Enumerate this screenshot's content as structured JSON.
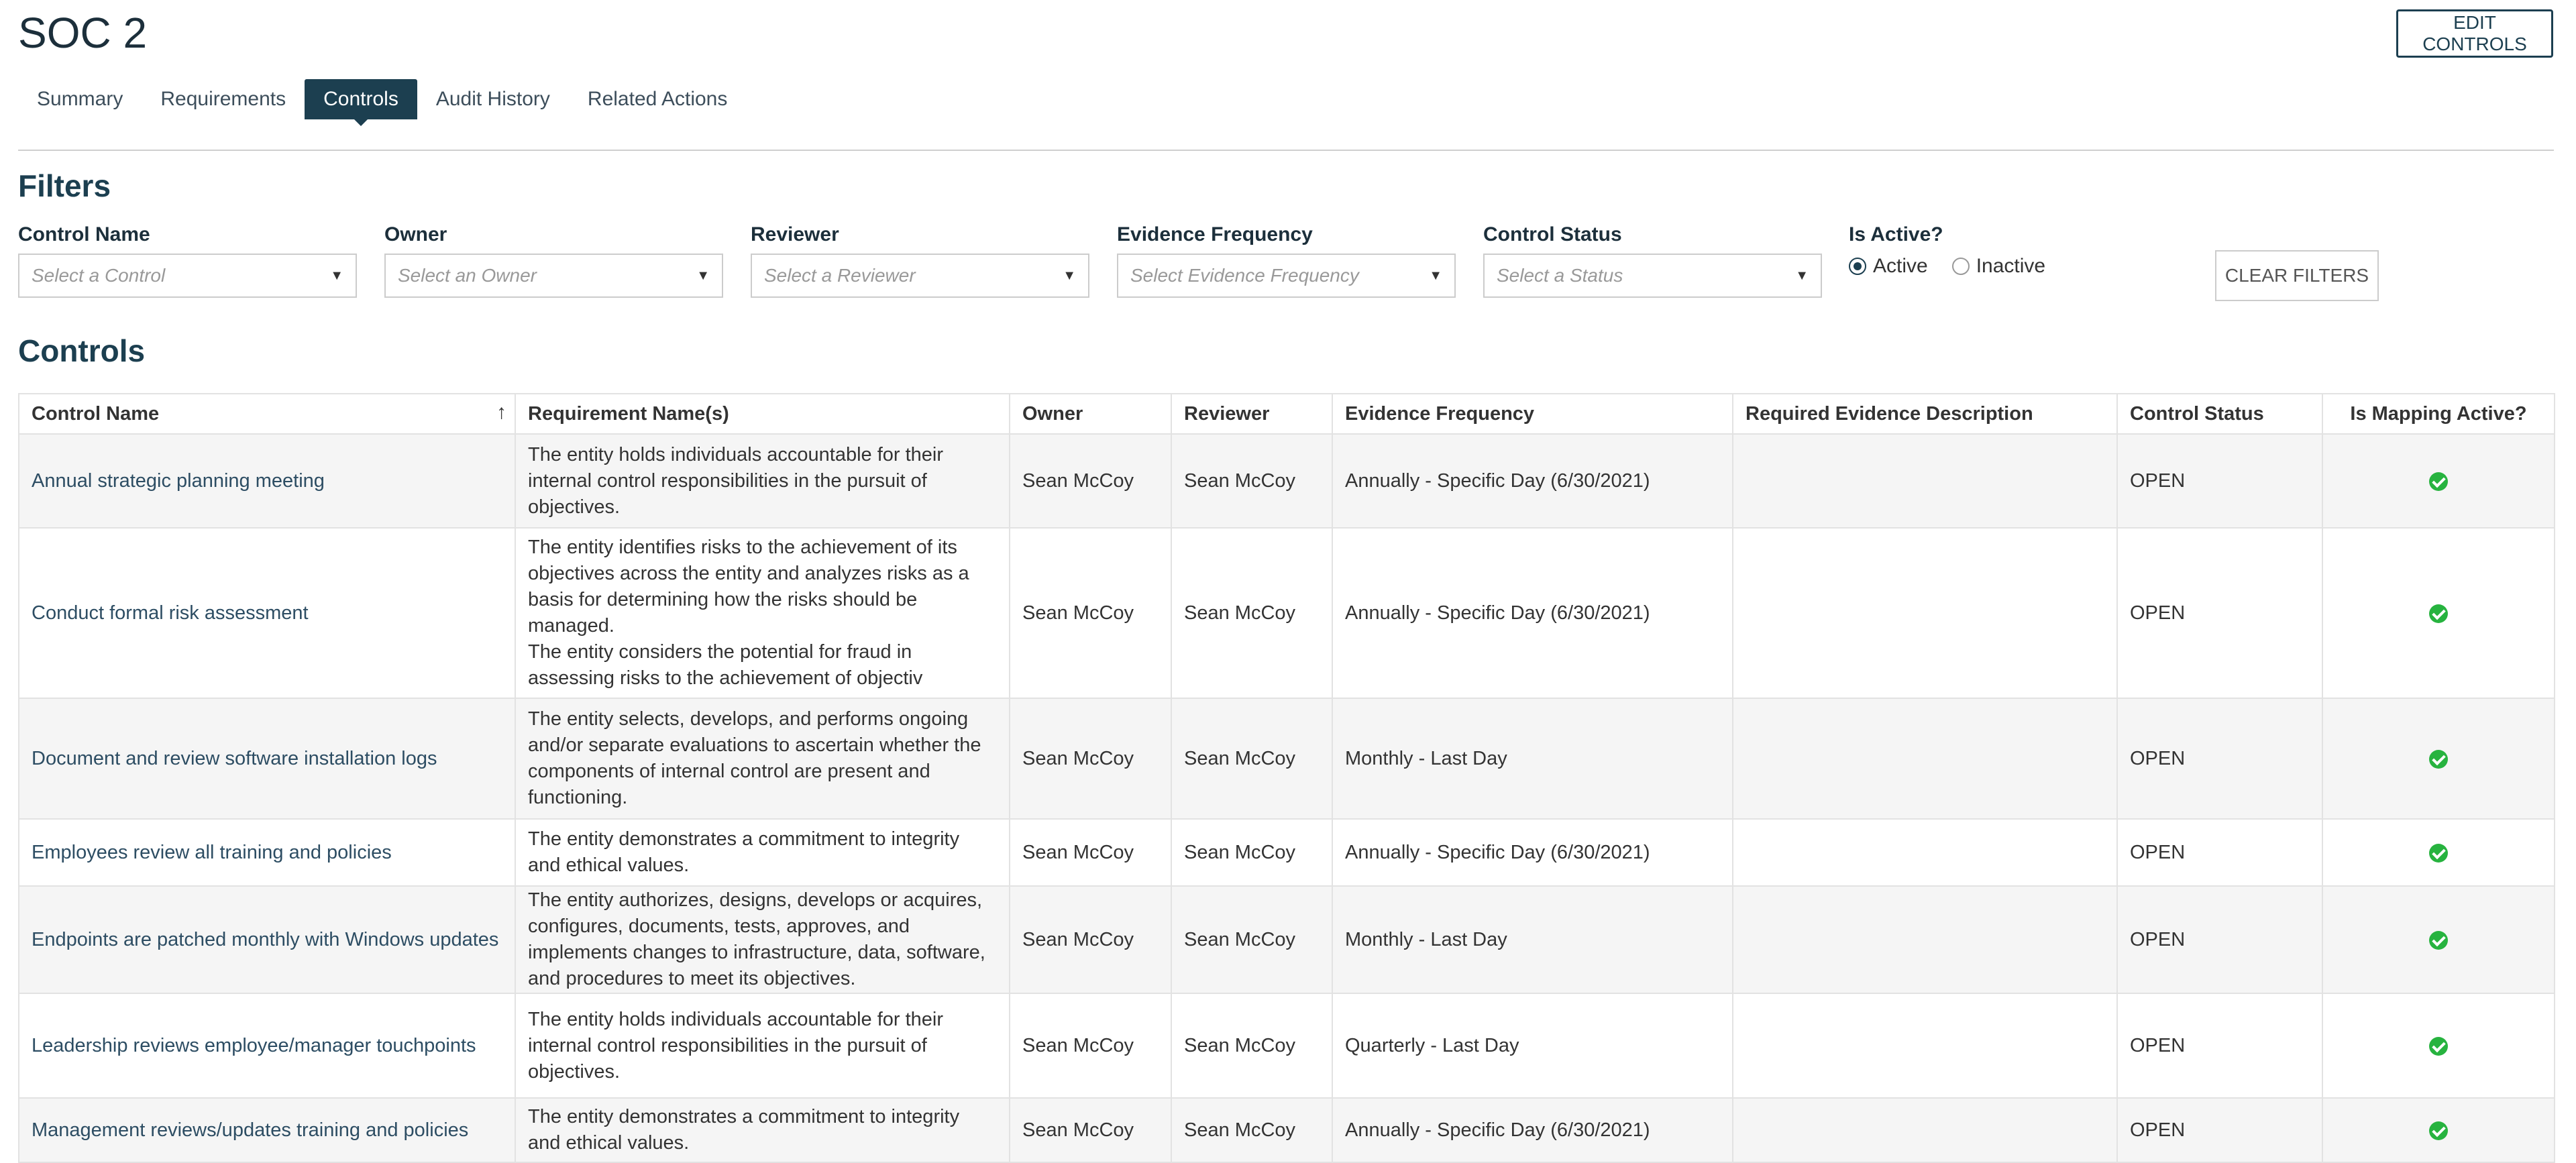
{
  "page": {
    "title": "SOC 2",
    "edit_controls": "EDIT CONTROLS"
  },
  "tabs": [
    {
      "label": "Summary",
      "active": false
    },
    {
      "label": "Requirements",
      "active": false
    },
    {
      "label": "Controls",
      "active": true
    },
    {
      "label": "Audit History",
      "active": false
    },
    {
      "label": "Related Actions",
      "active": false
    }
  ],
  "filters": {
    "title": "Filters",
    "control_name": {
      "label": "Control Name",
      "placeholder": "Select a Control"
    },
    "owner": {
      "label": "Owner",
      "placeholder": "Select an Owner"
    },
    "reviewer": {
      "label": "Reviewer",
      "placeholder": "Select a Reviewer"
    },
    "evidence_frequency": {
      "label": "Evidence Frequency",
      "placeholder": "Select Evidence Frequency"
    },
    "control_status": {
      "label": "Control Status",
      "placeholder": "Select a Status"
    },
    "is_active": {
      "label": "Is Active?",
      "options": [
        "Active",
        "Inactive"
      ],
      "selected": "Active"
    },
    "clear": "CLEAR FILTERS"
  },
  "controls": {
    "title": "Controls",
    "columns": [
      "Control Name",
      "Requirement Name(s)",
      "Owner",
      "Reviewer",
      "Evidence Frequency",
      "Required Evidence Description",
      "Control Status",
      "Is Mapping Active?"
    ],
    "sort_icon": "sort-ascending-icon",
    "rows": [
      {
        "name": "Annual strategic planning meeting",
        "requirement": "The entity holds individuals accountable for their internal control responsibilities in the pursuit of objectives.",
        "owner": "Sean McCoy",
        "reviewer": "Sean McCoy",
        "frequency": "Annually - Specific Day (6/30/2021)",
        "description": "",
        "status": "OPEN",
        "mapping_active": true
      },
      {
        "name": "Conduct formal risk assessment",
        "requirement": "The entity identifies risks to the achievement of its objectives across the entity and analyzes risks as a basis for determining how the risks should be managed.\nThe entity considers the potential for fraud in assessing risks to the achievement of objectiv",
        "owner": "Sean McCoy",
        "reviewer": "Sean McCoy",
        "frequency": "Annually - Specific Day (6/30/2021)",
        "description": "",
        "status": "OPEN",
        "mapping_active": true
      },
      {
        "name": "Document and review software installation logs",
        "requirement": "The entity selects, develops, and performs ongoing and/or separate evaluations to ascertain whether the components of internal control are present and functioning.",
        "owner": "Sean McCoy",
        "reviewer": "Sean McCoy",
        "frequency": "Monthly - Last Day",
        "description": "",
        "status": "OPEN",
        "mapping_active": true
      },
      {
        "name": "Employees review all training and policies",
        "requirement": "The entity demonstrates a commitment to integrity and ethical values.",
        "owner": "Sean McCoy",
        "reviewer": "Sean McCoy",
        "frequency": "Annually - Specific Day (6/30/2021)",
        "description": "",
        "status": "OPEN",
        "mapping_active": true
      },
      {
        "name": "Endpoints are patched monthly with Windows updates",
        "requirement": "The entity authorizes, designs, develops or acquires, configures, documents, tests, approves, and implements changes to infrastructure, data, software, and procedures to meet its objectives.",
        "owner": "Sean McCoy",
        "reviewer": "Sean McCoy",
        "frequency": "Monthly - Last Day",
        "description": "",
        "status": "OPEN",
        "mapping_active": true
      },
      {
        "name": "Leadership reviews employee/manager touchpoints",
        "requirement": "The entity holds individuals accountable for their internal control responsibilities in the pursuit of objectives.",
        "owner": "Sean McCoy",
        "reviewer": "Sean McCoy",
        "frequency": "Quarterly - Last Day",
        "description": "",
        "status": "OPEN",
        "mapping_active": true
      },
      {
        "name": "Management reviews/updates training and policies",
        "requirement": "The entity demonstrates a commitment to integrity and ethical values.",
        "owner": "Sean McCoy",
        "reviewer": "Sean McCoy",
        "frequency": "Annually - Specific Day (6/30/2021)",
        "description": "",
        "status": "OPEN",
        "mapping_active": true
      }
    ]
  }
}
